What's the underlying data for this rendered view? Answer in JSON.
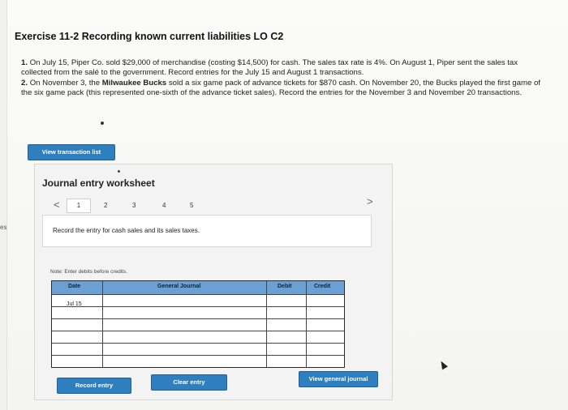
{
  "left_tab": "es",
  "title": "Exercise 11-2 Recording known current liabilities LO C2",
  "problem": {
    "item1_num": "1.",
    "item1_text": "On July 15, Piper Co. sold $29,000 of merchandise (costing $14,500) for cash. The sales tax rate is 4%. On August 1, Piper sent the sales tax collected from the salé to the government. Record entries for the July 15 and August 1 transactions.",
    "item2_num": "2.",
    "item2_pre": "On November 3, the ",
    "item2_bold": "Milwaukee Bucks",
    "item2_post": " sold a six game pack of advance tickets for $870 cash. On November 20, the Bucks played the first game of the six game pack (this represented one-sixth of the advance ticket sales). Record the entries for the November 3 and November 20 transactions."
  },
  "buttons": {
    "view_transaction_list": "View transaction list",
    "record_entry": "Record entry",
    "clear_entry": "Clear entry",
    "view_general_journal": "View general journal"
  },
  "worksheet": {
    "title": "Journal entry worksheet",
    "prev": "<",
    "next": ">",
    "pages": [
      "1",
      "2",
      "3",
      "4",
      "5"
    ],
    "instruction": "Record the entry for cash sales and its sales taxes.",
    "note": "Note: Enter debits before credits."
  },
  "journal": {
    "columns": [
      "Date",
      "General Journal",
      "Debit",
      "Credit"
    ],
    "rows": [
      {
        "date": "Jul 15",
        "account": "",
        "debit": "",
        "credit": ""
      },
      {
        "date": "",
        "account": "",
        "debit": "",
        "credit": ""
      },
      {
        "date": "",
        "account": "",
        "debit": "",
        "credit": ""
      },
      {
        "date": "",
        "account": "",
        "debit": "",
        "credit": ""
      },
      {
        "date": "",
        "account": "",
        "debit": "",
        "credit": ""
      },
      {
        "date": "",
        "account": "",
        "debit": "",
        "credit": ""
      }
    ]
  },
  "colors": {
    "button_blue": "#2f7fbf",
    "header_blue": "#6aa0d4"
  }
}
